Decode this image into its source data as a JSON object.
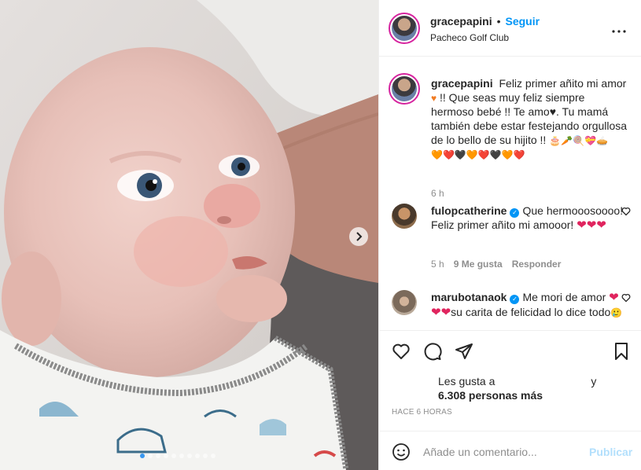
{
  "post": {
    "header": {
      "username": "gracepapini",
      "separator": "•",
      "follow_label": "Seguir",
      "location": "Pacheco Golf Club",
      "more_label": "•••"
    },
    "caption": {
      "username": "gracepapini",
      "text_part1": "Feliz primer añito mi amor",
      "text_part2": "!! Que seas muy feliz siempre hermoso bebé !! Te amo♥. Tu mamá también debe estar festejando orgullosa de lo bello de su hijito !!",
      "emoji_row1": "🎂🥕🍭💝🥧",
      "emoji_row2": "🧡❤️🖤🧡❤️🖤🧡❤️",
      "time": "6 h"
    },
    "comments": [
      {
        "username": "fulopcatherine",
        "verified": true,
        "text": "Que hermooosoooo! Feliz primer añito mi amooor!",
        "hearts": "❤❤❤",
        "time": "5 h",
        "likes": "9 Me gusta",
        "reply": "Responder"
      },
      {
        "username": "marubotanaok",
        "verified": true,
        "text_part1": "Me mori de amor",
        "hearts": "❤❤❤",
        "text_part2": "su carita de felicidad lo dice todo",
        "emoji_end": "🥲"
      }
    ],
    "likes": {
      "prefix": "Les gusta a",
      "suffix": "y",
      "others": "6.308 personas más"
    },
    "time_ago": "HACE 6 HORAS",
    "add_comment": {
      "placeholder": "Añade un comentario...",
      "publish": "Publicar"
    },
    "icons": {
      "like": "heart-icon",
      "comment": "comment-icon",
      "share": "share-icon",
      "save": "bookmark-icon",
      "emoji": "smiley-icon",
      "next": "chevron-right-icon"
    },
    "carousel": {
      "slides": 10,
      "active": 1
    },
    "colors": {
      "accent": "#0095f6",
      "heart": "#e0245e",
      "ring": "#d6249f",
      "muted": "#8e8e8e"
    }
  }
}
